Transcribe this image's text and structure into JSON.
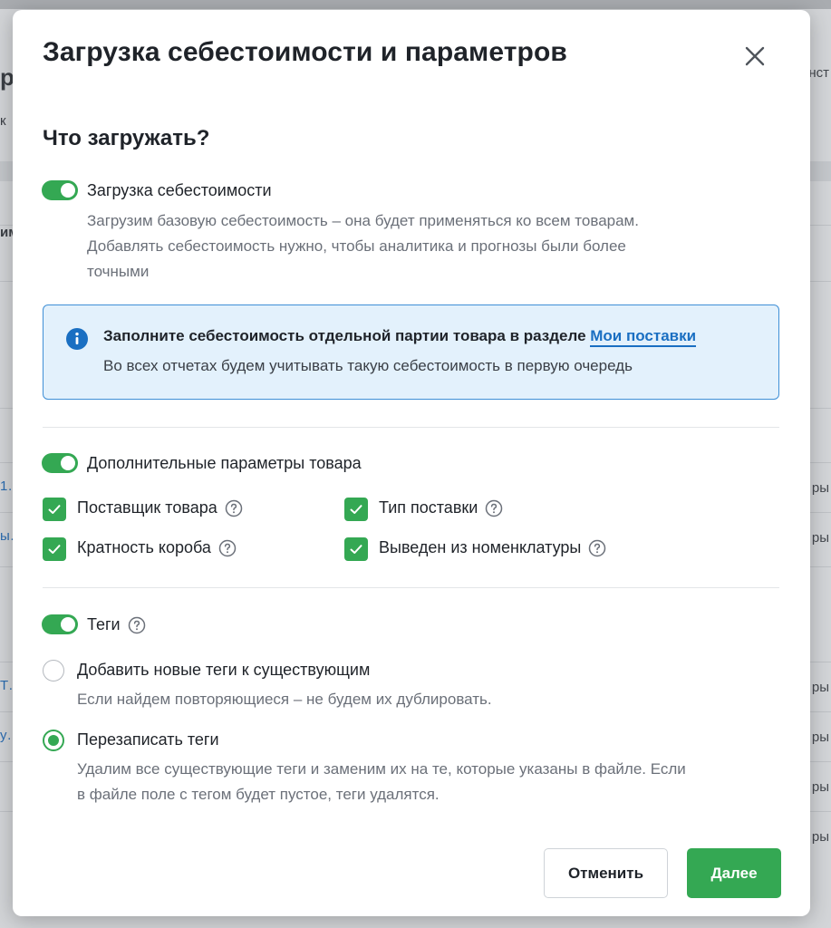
{
  "background": {
    "left_fragments": [
      "р",
      "к",
      "им",
      "1…",
      "ы…",
      "Т…",
      "у…"
    ],
    "right_fragments": [
      "онст",
      "ры",
      "ры",
      "ры",
      "ры",
      "ры",
      "ры"
    ]
  },
  "modal": {
    "title": "Загрузка себестоимости и параметров",
    "close_icon": "close-icon",
    "section_heading": "Что загружать?",
    "cost_upload": {
      "label": "Загрузка себестоимости",
      "enabled": true,
      "description_lines": [
        "Загрузим базовую себестоимость – она будет применяться ко всем товарам.",
        "Добавлять себестоимость нужно, чтобы аналитика и прогнозы были более",
        "точными"
      ]
    },
    "info_box": {
      "icon": "info-icon",
      "text_bold": "Заполните себестоимость отдельной партии товара в разделе",
      "link_text": "Мои поставки",
      "text_secondary": "Во всех отчетах будем учитывать такую себестоимость в первую очередь"
    },
    "extra_params": {
      "label": "Дополнительные параметры товара",
      "enabled": true,
      "checkboxes": [
        {
          "label": "Поставщик товара",
          "checked": true
        },
        {
          "label": "Тип поставки",
          "checked": true
        },
        {
          "label": "Кратность короба",
          "checked": true
        },
        {
          "label": "Выведен из номенклатуры",
          "checked": true
        }
      ]
    },
    "tags": {
      "label": "Теги",
      "enabled": true,
      "options": [
        {
          "label": "Добавить новые теги к существующим",
          "description": "Если найдем повторяющиеся – не будем их дублировать.",
          "selected": false
        },
        {
          "label": "Перезаписать теги",
          "description_lines": [
            "Удалим все существующие теги и заменим их на те, которые указаны в файле. Если",
            "в файле поле с тегом будет пустое, теги удалятся."
          ],
          "selected": true
        }
      ]
    },
    "buttons": {
      "cancel": "Отменить",
      "next": "Далее"
    },
    "colors": {
      "accent_green": "#34a853",
      "link_blue": "#1a6fc2",
      "info_bg": "#e3f1fc",
      "info_border": "#3f8fd6"
    }
  }
}
